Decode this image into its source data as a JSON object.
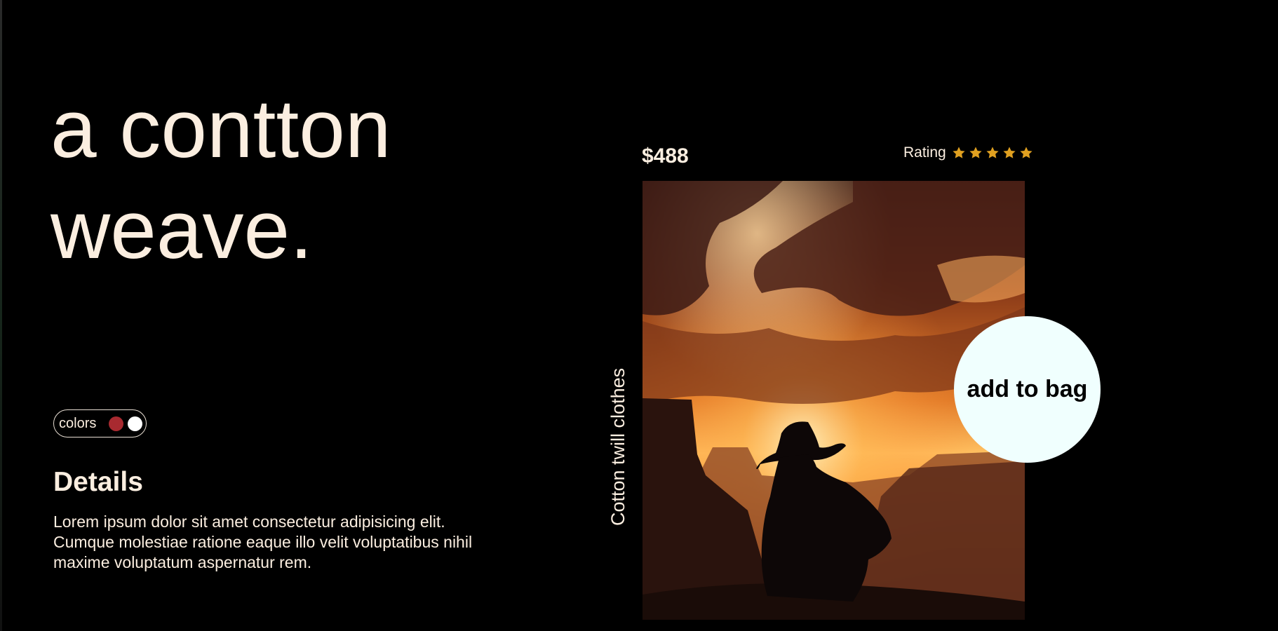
{
  "hero": {
    "line1": "a contton",
    "line2": "weave."
  },
  "colors": {
    "label": "colors",
    "swatches": [
      {
        "name": "red",
        "hex": "#a82a30"
      },
      {
        "name": "white",
        "hex": "#ffffff"
      }
    ]
  },
  "details": {
    "title": "Details",
    "text": "Lorem ipsum dolor sit amet consectetur adipisicing elit. Cumque molestiae ratione eaque illo velit voluptatibus nihil maxime voluptatum aspernatur rem."
  },
  "product": {
    "price": "$488",
    "rating_label": "Rating",
    "rating_stars": 5,
    "vertical_label": "Cotton twill clothes",
    "image_alt": "sunset-canyon-cowboy-photo",
    "add_to_bag": "add to bag"
  },
  "theme": {
    "background": "#000000",
    "text": "#fbeee0",
    "star": "#e0a020",
    "button_bg": "#f0fffe"
  }
}
